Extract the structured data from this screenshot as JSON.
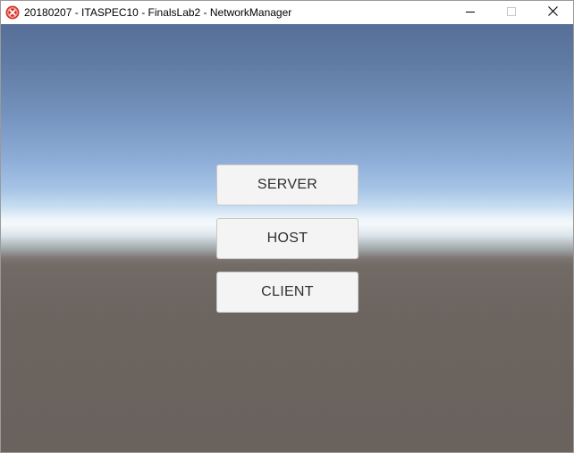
{
  "window": {
    "title": "20180207 - ITASPEC10 - FinalsLab2 - NetworkManager",
    "app_icon": "unity-error-icon",
    "controls": {
      "minimize_icon": "minimize-icon",
      "maximize_icon": "maximize-icon",
      "close_icon": "close-icon"
    }
  },
  "menu": {
    "buttons": [
      {
        "label": "SERVER"
      },
      {
        "label": "HOST"
      },
      {
        "label": "CLIENT"
      }
    ]
  },
  "colors": {
    "sky_top": "#576f98",
    "horizon": "#f4f8fb",
    "ground": "#6a625d",
    "button_bg": "#f4f4f4",
    "button_text": "#303030",
    "app_icon_red": "#d9342b"
  }
}
